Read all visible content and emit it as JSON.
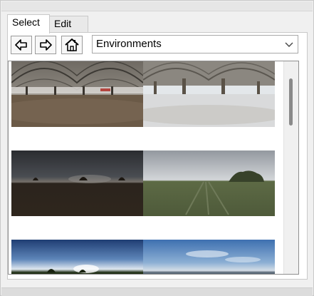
{
  "tabs": [
    {
      "label": "Select",
      "active": true
    },
    {
      "label": "Edit",
      "active": false
    }
  ],
  "toolbar": {
    "back_icon": "arrow-left-icon",
    "forward_icon": "arrow-right-icon",
    "home_icon": "home-icon"
  },
  "library": {
    "selected": "Environments",
    "dropdown_icon": "chevron-down-icon"
  },
  "thumbnails": [
    {
      "scene": "indoor-arena-hdri"
    },
    {
      "scene": "snowy-pavilion-hdri"
    },
    {
      "scene": "dusk-field-hdri"
    },
    {
      "scene": "overcast-meadow-hdri"
    },
    {
      "scene": "blue-sky-sunrise-hdri"
    },
    {
      "scene": "clear-sky-horizon-hdri"
    }
  ]
}
